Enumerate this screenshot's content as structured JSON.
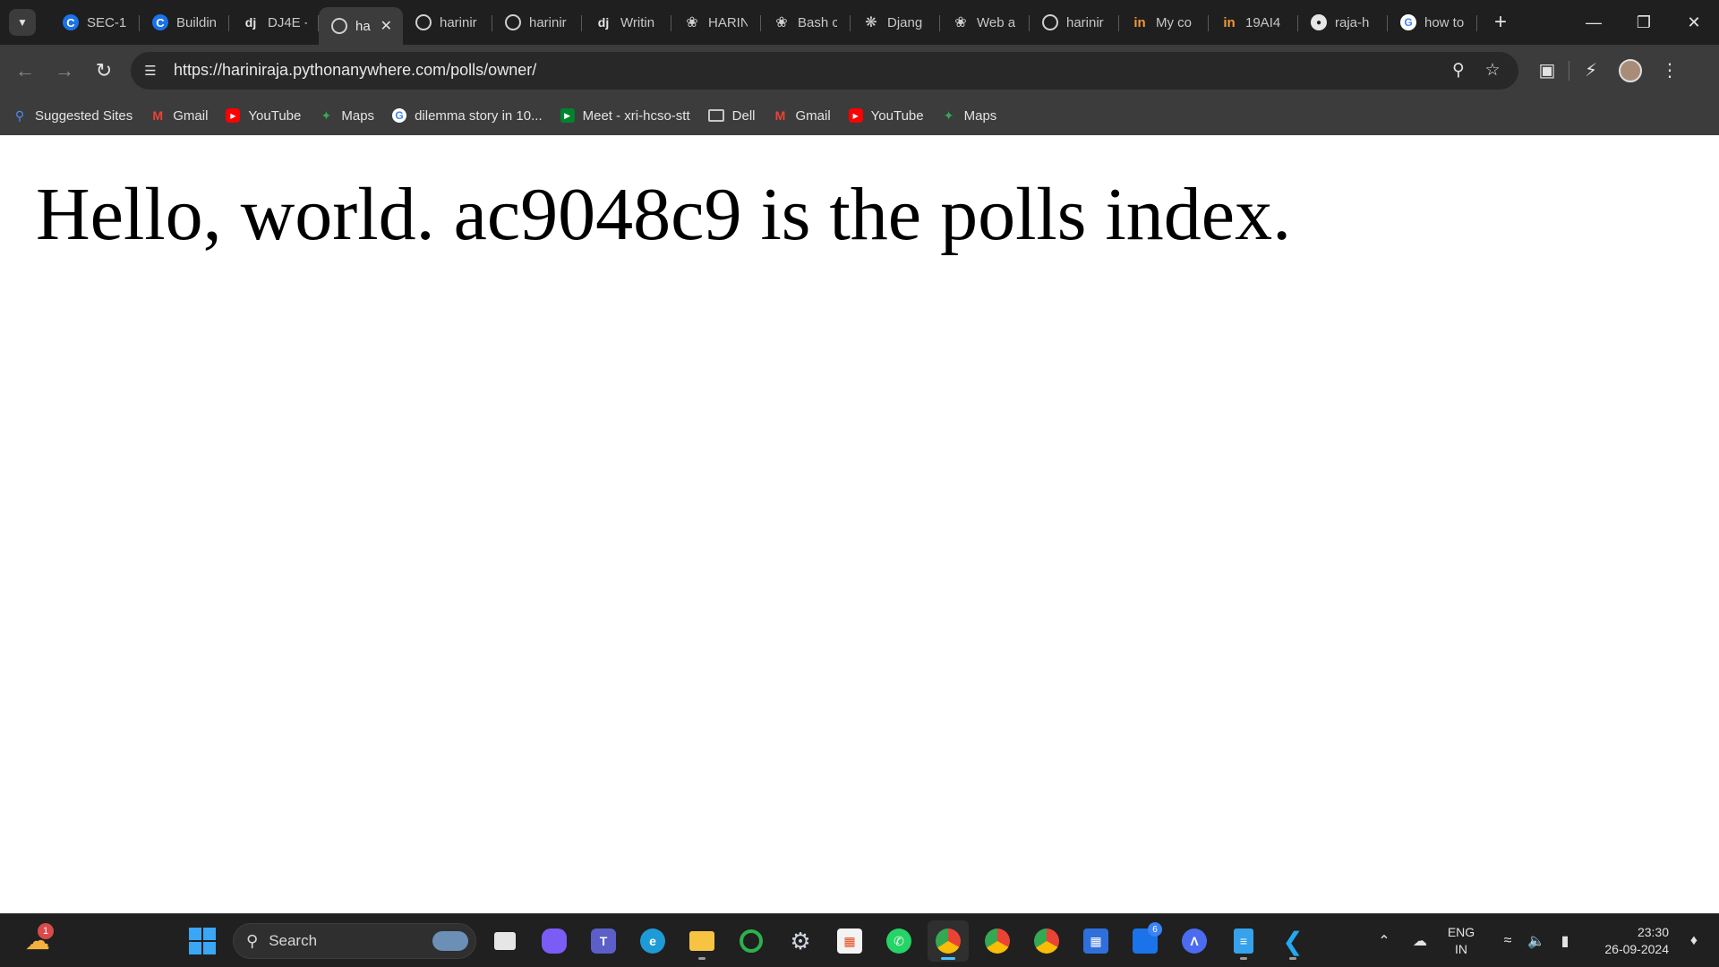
{
  "browser": {
    "tabs": [
      {
        "label": "SEC-1",
        "icon": "coursera-c-icon"
      },
      {
        "label": "Buildin",
        "icon": "coursera-c-icon"
      },
      {
        "label": "DJ4E -",
        "icon": "django-dj-icon"
      },
      {
        "label": "ha",
        "icon": "globe-icon",
        "active": true
      },
      {
        "label": "harinir",
        "icon": "globe-icon"
      },
      {
        "label": "harinir",
        "icon": "globe-icon"
      },
      {
        "label": "Writin",
        "icon": "django-dj-icon"
      },
      {
        "label": "HARIN",
        "icon": "feather-icon"
      },
      {
        "label": "Bash c",
        "icon": "feather-icon"
      },
      {
        "label": "Djang",
        "icon": "chatgpt-icon"
      },
      {
        "label": "Web a",
        "icon": "feather-icon"
      },
      {
        "label": "harinir",
        "icon": "globe-icon"
      },
      {
        "label": "My co",
        "icon": "internshala-icon"
      },
      {
        "label": "19AI4",
        "icon": "internshala-icon"
      },
      {
        "label": "raja-h",
        "icon": "github-icon"
      },
      {
        "label": "how to",
        "icon": "google-icon"
      }
    ],
    "url": "https://hariniraja.pythonanywhere.com/polls/owner/",
    "bookmarks": [
      {
        "label": "Suggested Sites",
        "icon": "search-icon"
      },
      {
        "label": "Gmail",
        "icon": "gmail-icon"
      },
      {
        "label": "YouTube",
        "icon": "youtube-icon"
      },
      {
        "label": "Maps",
        "icon": "maps-icon"
      },
      {
        "label": "dilemma story in 10...",
        "icon": "google-icon"
      },
      {
        "label": "Meet - xri-hcso-stt",
        "icon": "meet-icon"
      },
      {
        "label": "Dell",
        "icon": "folder-icon"
      },
      {
        "label": "Gmail",
        "icon": "gmail-icon"
      },
      {
        "label": "YouTube",
        "icon": "youtube-icon"
      },
      {
        "label": "Maps",
        "icon": "maps-icon"
      }
    ]
  },
  "page": {
    "heading": "Hello, world. ac9048c9 is the polls index."
  },
  "taskbar": {
    "weather_badge": "1",
    "search_placeholder": "Search",
    "store_badge": "6",
    "language": "ENG",
    "region": "IN",
    "time": "23:30",
    "date": "26-09-2024"
  },
  "colors": {
    "tabstrip": "#1f1f1f",
    "toolbar": "#3c3c3c",
    "omnibox": "#282828",
    "taskbar": "#202020",
    "accent": "#4cc2ff"
  }
}
